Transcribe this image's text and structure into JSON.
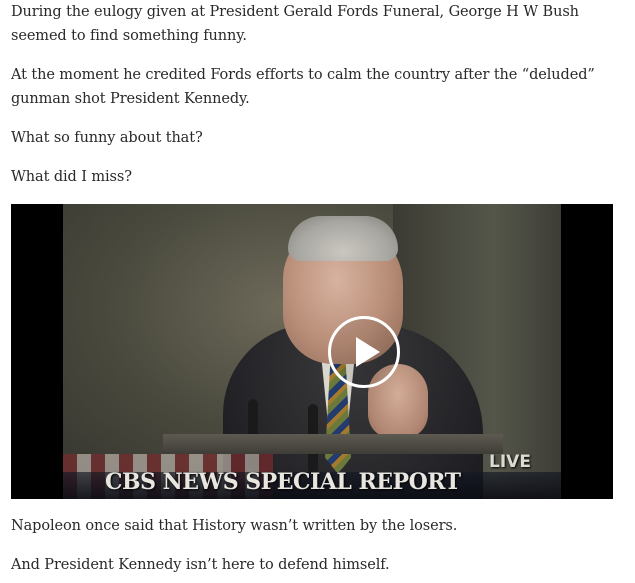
{
  "article": {
    "paragraphs": [
      "During the eulogy given at President Gerald Fords Funeral, George H W Bush seemed to find something funny.",
      "At the moment he credited Fords efforts to calm the country after the “deluded” gunman shot President Kennedy.",
      "What so funny about that?",
      "What did I miss?"
    ],
    "after_video": [
      "Napoleon once said that History wasn’t written by the losers.",
      "And President Kennedy isn’t here to defend himself."
    ]
  },
  "video": {
    "overlay_banner": "CBS NEWS SPECIAL REPORT",
    "overlay_live": "LIVE",
    "play_icon": "play-icon"
  }
}
